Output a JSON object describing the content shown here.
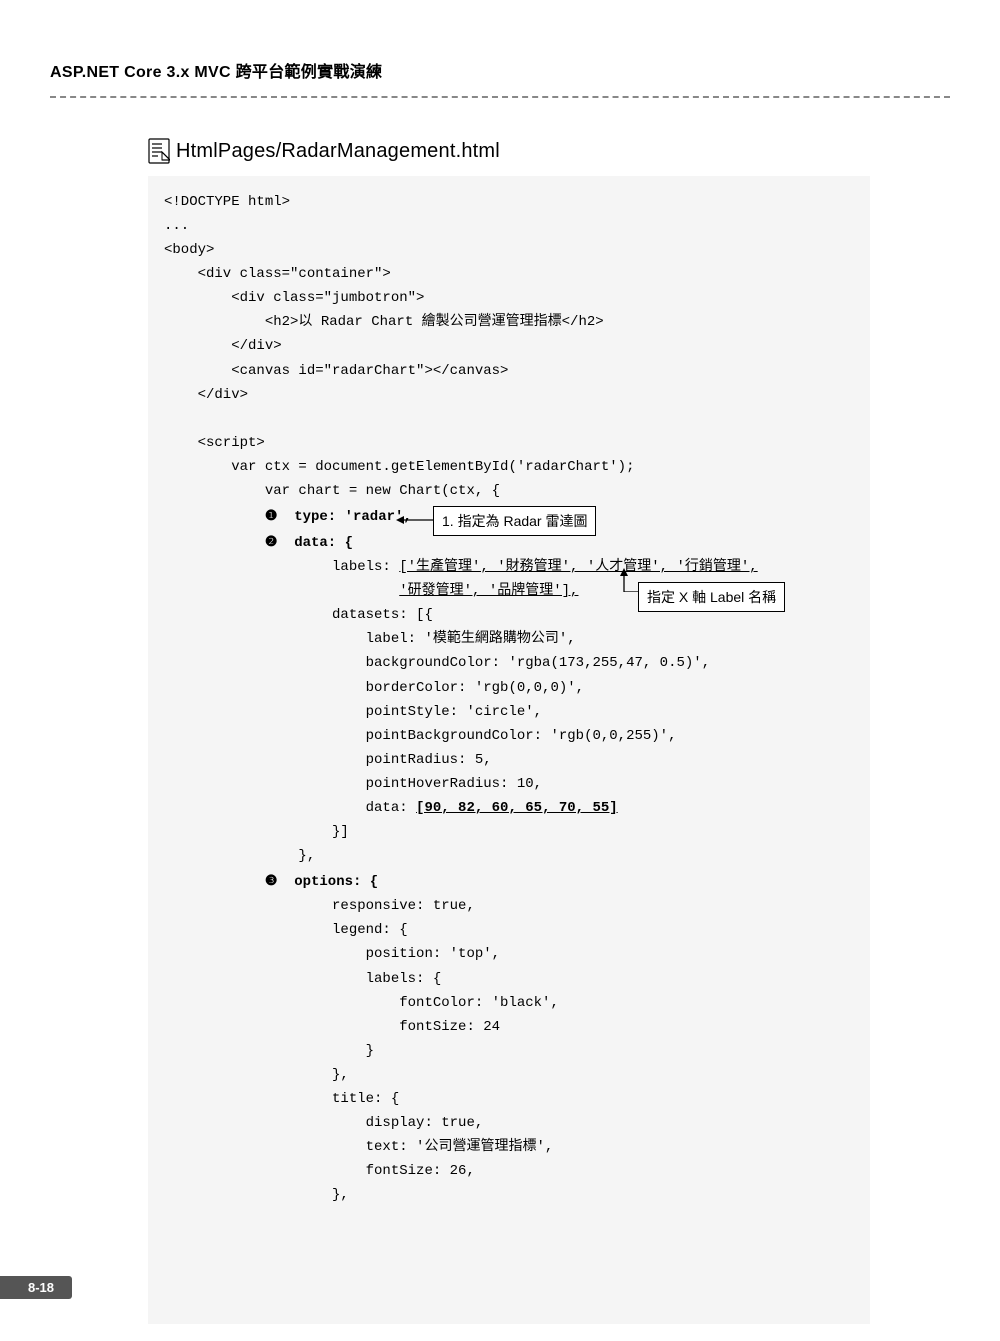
{
  "header": {
    "title": "ASP.NET Core 3.x MVC 跨平台範例實戰演練"
  },
  "file": {
    "title": "HtmlPages/RadarManagement.html"
  },
  "code": {
    "line01": "<!DOCTYPE html>",
    "line02": "...",
    "line03": "<body>",
    "line04": "    <div class=\"container\">",
    "line05": "        <div class=\"jumbotron\">",
    "line06": "            <h2>以 Radar Chart 繪製公司營運管理指標</h2>",
    "line07": "        </div>",
    "line08": "        <canvas id=\"radarChart\"></canvas>",
    "line09": "    </div>",
    "line10": "",
    "line11": "    <script>",
    "line12": "        var ctx = document.getElementById('radarChart');",
    "line13": "            var chart = new Chart(ctx, {",
    "line14a": "            ",
    "bullet1": "❶",
    "line14b": "  type: 'radar',",
    "line15a": "            ",
    "bullet2": "❷",
    "line15b": "  data: {",
    "line16a": "                    labels: ",
    "line16b": "['生產管理', '財務管理', '人才管理', '行銷管理',",
    "line17a": "                            ",
    "line17b": "'研發管理', '品牌管理'],",
    "line18": "                    datasets: [{",
    "line19": "                        label: '模範生網路購物公司',",
    "line20": "                        backgroundColor: 'rgba(173,255,47, 0.5)',",
    "line21": "                        borderColor: 'rgb(0,0,0)',",
    "line22": "                        pointStyle: 'circle',",
    "line23": "                        pointBackgroundColor: 'rgb(0,0,255)',",
    "line24": "                        pointRadius: 5,",
    "line25": "                        pointHoverRadius: 10,",
    "line26a": "                        data: ",
    "line26b": "[90, 82, 60, 65, 70, 55]",
    "line27": "                    }]",
    "line28": "                },",
    "line29a": "            ",
    "bullet3": "❸",
    "line29b": "  options: {",
    "line30": "                    responsive: true,",
    "line31": "                    legend: {",
    "line32": "                        position: 'top',",
    "line33": "                        labels: {",
    "line34": "                            fontColor: 'black',",
    "line35": "                            fontSize: 24",
    "line36": "                        }",
    "line37": "                    },",
    "line38": "                    title: {",
    "line39": "                        display: true,",
    "line40": "                        text: '公司營運管理指標',",
    "line41": "                        fontSize: 26,",
    "line42": "                    },"
  },
  "callouts": {
    "c1": "1. 指定為 Radar 雷達圖",
    "c2": "指定 X 軸 Label 名稱"
  },
  "footer": {
    "page": "8-18"
  }
}
